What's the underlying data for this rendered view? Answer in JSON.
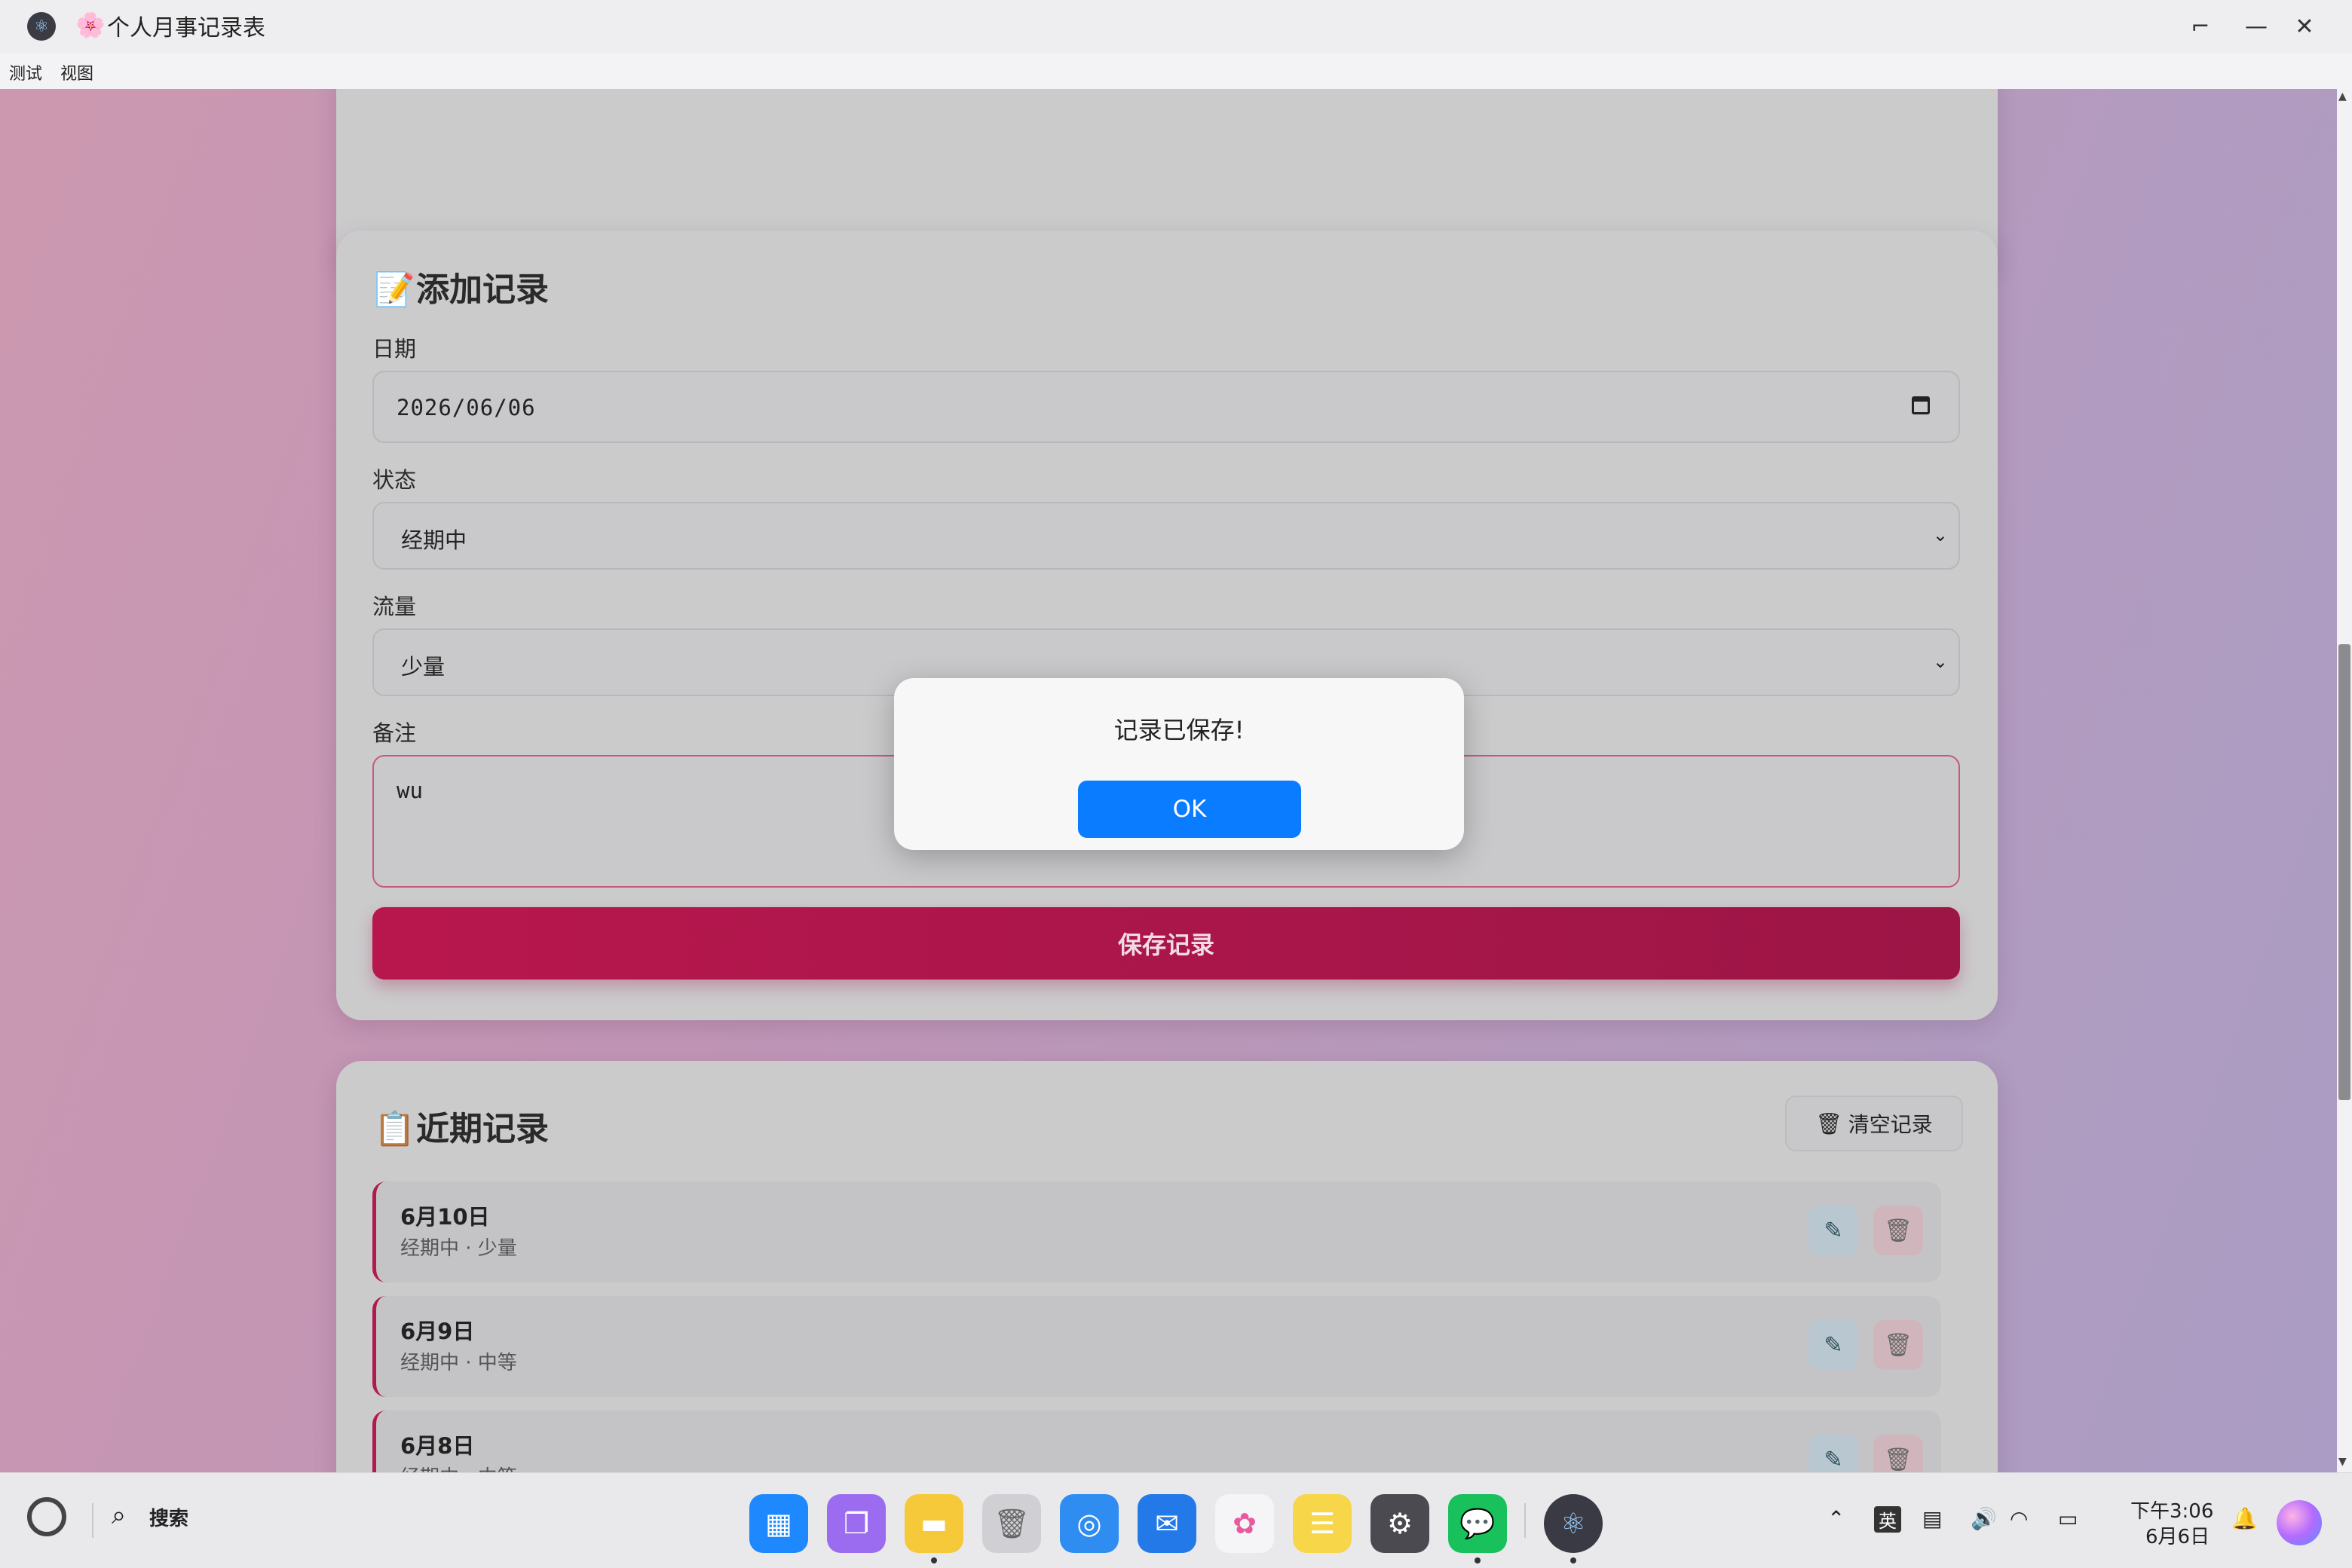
{
  "window": {
    "title": "个人月事记录表",
    "title_emoji": "🌸",
    "controls": {
      "restore": "⌐",
      "minimize": "—",
      "close": "✕"
    }
  },
  "menu": [
    "测试",
    "视图"
  ],
  "add_card": {
    "title_icon": "📝",
    "title": "添加记录",
    "date_label": "日期",
    "date_value": "2026/06/06",
    "status_label": "状态",
    "status_value": "经期中",
    "flow_label": "流量",
    "flow_value": "少量",
    "notes_label": "备注",
    "notes_value": "wu",
    "save_label": "保存记录"
  },
  "recent_card": {
    "title_icon": "📋",
    "title": "近期记录",
    "clear_icon": "🗑",
    "clear_label": "清空记录",
    "records": [
      {
        "date": "6月10日",
        "sub": "经期中 · 少量"
      },
      {
        "date": "6月9日",
        "sub": "经期中 · 中等"
      },
      {
        "date": "6月8日",
        "sub": "经期中 · 中等"
      }
    ]
  },
  "modal": {
    "message": "记录已保存!",
    "ok_label": "OK"
  },
  "taskbar": {
    "search_label": "搜索",
    "ime": "英",
    "clock_time": "下午3:06",
    "clock_date": "6月6日"
  },
  "colors": {
    "accent": "#b0174c",
    "ok_button": "#0a7cff",
    "background": "#c09ab8"
  }
}
